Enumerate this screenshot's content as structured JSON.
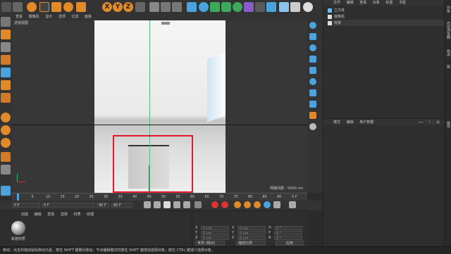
{
  "toolbar": {
    "coords_x": "X",
    "coords_y": "Y",
    "coords_z": "Z"
  },
  "viewport": {
    "menu": [
      "查看",
      "摄像机",
      "显示",
      "选项",
      "过滤",
      "面板"
    ],
    "name": "透视视图",
    "grid_label": "网格间距 : 5000 cm"
  },
  "timeline": {
    "ticks": [
      "0",
      "5",
      "10",
      "15",
      "20",
      "25",
      "30",
      "35",
      "40",
      "45",
      "50",
      "55",
      "60",
      "65",
      "70",
      "75",
      "80",
      "85",
      "90"
    ],
    "end_frame": "0 F",
    "start": "0 F",
    "current": "0 F",
    "end": "90 F",
    "max": "90 F"
  },
  "material_panel": {
    "menu": [
      "创建",
      "编辑",
      "查看",
      "选择",
      "材质",
      "纹理"
    ],
    "material_name": "新建材质"
  },
  "coordinates": {
    "rows": [
      {
        "axis": "X",
        "value": "0 cm",
        "axis2": "X",
        "value2": "0 cm",
        "axis3": "H",
        "value3": "0 °"
      },
      {
        "axis": "Y",
        "value": "0 cm",
        "axis2": "Y",
        "value2": "0 cm",
        "axis3": "P",
        "value3": "0 °"
      },
      {
        "axis": "Z",
        "value": "0 cm",
        "axis2": "Z",
        "value2": "0 cm",
        "axis3": "B",
        "value3": "0 °"
      }
    ],
    "mode": "世界 (相对)",
    "size_mode": "缩放比例",
    "apply": "应用"
  },
  "object_manager": {
    "menu": [
      "文件",
      "编辑",
      "查看",
      "对象",
      "标签",
      "书签"
    ],
    "objects": [
      {
        "name": "立方体",
        "color": "#66bbff"
      },
      {
        "name": "摄像机",
        "color": "#dddddd"
      },
      {
        "name": "背景",
        "color": "#dddddd"
      }
    ]
  },
  "attribute_manager": {
    "menu": [
      "模式",
      "编辑",
      "用户数据"
    ]
  },
  "side_tabs": [
    "对象",
    "内容浏览器",
    "构造",
    "层",
    "属性"
  ],
  "status_bar": {
    "text": "移动：点击并拖动鼠标移动元素。按住 SHIFT 键量化移动；节点编辑模式时按住 SHIFT 键增加选择对象；按住 CTRL 键减少选择对象。"
  },
  "colors": {
    "selection_rect": "#e0192a",
    "accent_blue": "#4aa3df",
    "orange": "#e68a2e"
  }
}
